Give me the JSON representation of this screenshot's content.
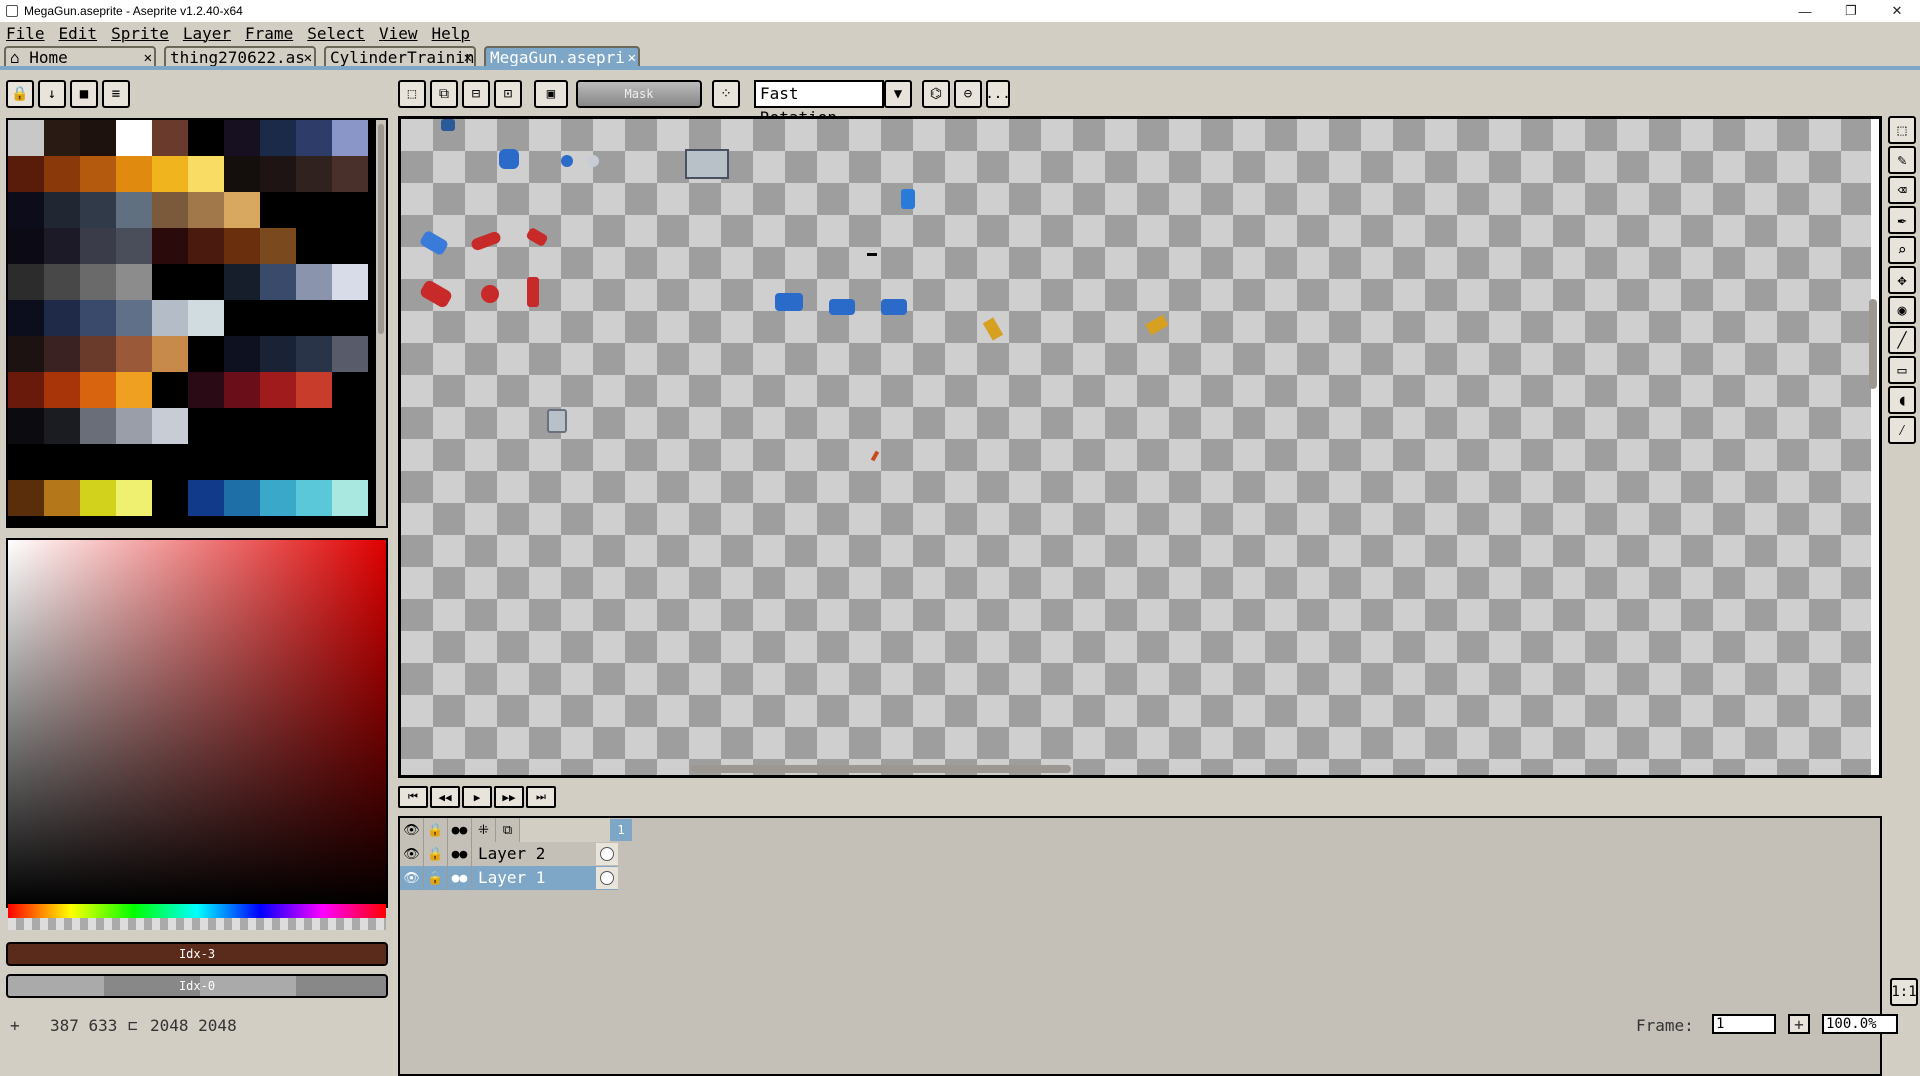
{
  "window": {
    "title": "MegaGun.aseprite - Aseprite v1.2.40-x64",
    "controls": [
      "—",
      "❐",
      "✕"
    ]
  },
  "menu": [
    "File",
    "Edit",
    "Sprite",
    "Layer",
    "Frame",
    "Select",
    "View",
    "Help"
  ],
  "tabs": [
    {
      "label": "⌂ Home",
      "close": "✕"
    },
    {
      "label": "thing270622.as",
      "close": "✕"
    },
    {
      "label": "CylinderTrainin",
      "close": "✕"
    },
    {
      "label": "MegaGun.asepri",
      "close": "✕"
    }
  ],
  "toolbar": {
    "mask_label": "Mask",
    "rotation_value": "Fast Rotation",
    "ellipsis": "..."
  },
  "palette_colors": [
    "#c8c8c8",
    "#2a1a14",
    "#1e120e",
    "#fff",
    "#6a3a2c",
    "#000",
    "#161020",
    "#1c2a4a",
    "#2e3c6a",
    "#8a96c8",
    "#5a1c0a",
    "#8a3a0a",
    "#b45a0e",
    "#e08a10",
    "#f0b41e",
    "#f8dc64",
    "#140e0c",
    "#1e1414",
    "#30221e",
    "#4a302a",
    "#0c0c1a",
    "#202632",
    "#303a48",
    "#607080",
    "#7a5a3a",
    "#a0784a",
    "#d8a860",
    "#000",
    "#000",
    "#000",
    "#0c0a14",
    "#1c1a26",
    "#3a3c4a",
    "#4a4e5a",
    "#2a0a0a",
    "#4a1a0e",
    "#6a300e",
    "#7a4a1e",
    "#000",
    "#000",
    "#2c2c2c",
    "#484848",
    "#6a6a6a",
    "#8c8c8c",
    "#000",
    "#000",
    "#161e2c",
    "#3a4a6a",
    "#8a94ac",
    "#d8dce8",
    "#0c0e1e",
    "#1e2a48",
    "#3a4a6a",
    "#607088",
    "#b4bcc8",
    "#d0dce0",
    "#000",
    "#000",
    "#000",
    "#000",
    "#1c1212",
    "#3a2222",
    "#6a3a2a",
    "#9a5a3a",
    "#c88a4a",
    "#000",
    "#0e1220",
    "#1a2236",
    "#2a3448",
    "#585c6a",
    "#6a1a0a",
    "#a8340a",
    "#d86410",
    "#f0a020",
    "#000",
    "#2a0a14",
    "#6a0e1a",
    "#a01c1c",
    "#c83c2c",
    "#000",
    "#0c0c10",
    "#1a1c22",
    "#6a6e78",
    "#9a9ea8",
    "#c8ccd4",
    "#000",
    "#000",
    "#000",
    "#000",
    "#000",
    "#000",
    "#000",
    "#000",
    "#000",
    "#000",
    "#000",
    "#000",
    "#000",
    "#000",
    "#000",
    "#5a2e0a",
    "#b4781a",
    "#d2d21c",
    "#f0f070",
    "#000",
    "#123a8a",
    "#1e6ea8",
    "#3aa8c8",
    "#5ac8d8",
    "#a8e8e0"
  ],
  "fg_index": "Idx-3",
  "bg_index": "Idx-0",
  "tools": [
    "⬚",
    "✎",
    "⌫",
    "✒",
    "⌕",
    "✥",
    "◉",
    "╱",
    "▭",
    "◖",
    "⁄"
  ],
  "timeline": {
    "buttons": [
      "⏮",
      "◀◀",
      "▶",
      "▶▶",
      "⏭"
    ],
    "frame_number": "1",
    "layers": [
      {
        "name": "Layer 2",
        "selected": false
      },
      {
        "name": "Layer 1",
        "selected": true
      }
    ]
  },
  "status": {
    "coords": "387 633",
    "size": "2048 2048",
    "frame_label": "Frame:",
    "frame_value": "1",
    "zoom_value": "100.0%"
  }
}
